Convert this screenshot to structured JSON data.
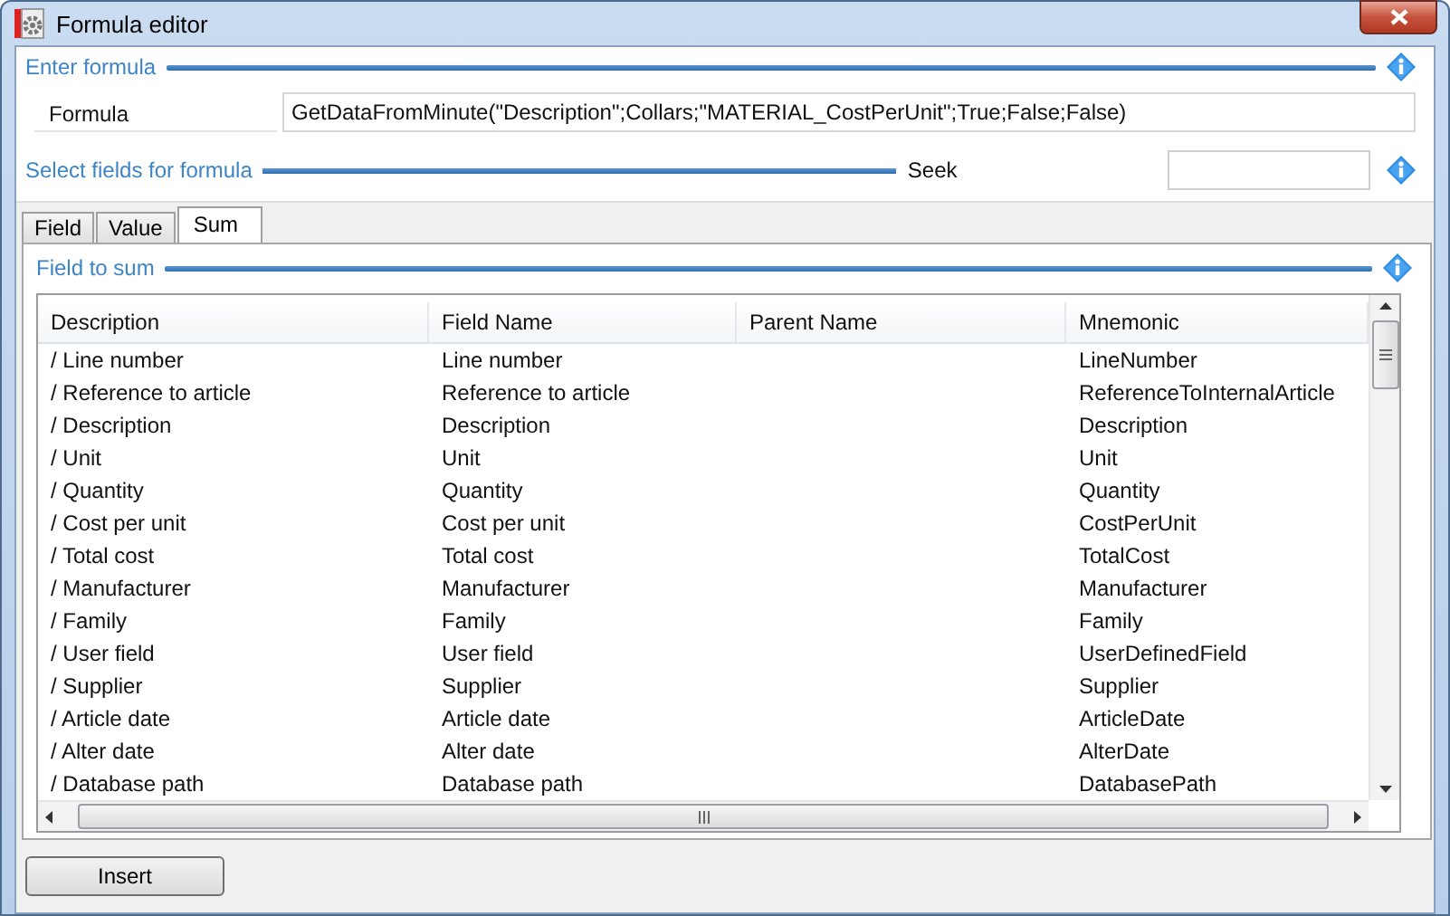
{
  "window": {
    "title": "Formula editor"
  },
  "formula_section": {
    "legend": "Enter formula",
    "label": "Formula",
    "value": "GetDataFromMinute(\"Description\";Collars;\"MATERIAL_CostPerUnit\";True;False;False)"
  },
  "fields_section": {
    "legend": "Select fields for formula",
    "seek_label": "Seek"
  },
  "tabs": [
    {
      "label": "Field",
      "selected": false
    },
    {
      "label": "Value",
      "selected": false
    },
    {
      "label": "Sum",
      "selected": true
    }
  ],
  "sum_panel": {
    "legend": "Field to sum"
  },
  "table": {
    "columns": [
      "Description",
      "Field Name",
      "Parent Name",
      "Mnemonic"
    ],
    "rows": [
      {
        "description": "/ Line number",
        "field_name": "Line number",
        "mnemonic": "LineNumber"
      },
      {
        "description": "/ Reference to article",
        "field_name": "Reference to article",
        "mnemonic": "ReferenceToInternalArticle"
      },
      {
        "description": "/ Description",
        "field_name": "Description",
        "mnemonic": "Description"
      },
      {
        "description": "/ Unit",
        "field_name": "Unit",
        "mnemonic": "Unit"
      },
      {
        "description": "/ Quantity",
        "field_name": "Quantity",
        "mnemonic": "Quantity"
      },
      {
        "description": "/ Cost per unit",
        "field_name": "Cost per unit",
        "mnemonic": "CostPerUnit"
      },
      {
        "description": "/ Total cost",
        "field_name": "Total cost",
        "mnemonic": "TotalCost"
      },
      {
        "description": "/ Manufacturer",
        "field_name": "Manufacturer",
        "mnemonic": "Manufacturer"
      },
      {
        "description": "/ Family",
        "field_name": "Family",
        "mnemonic": "Family"
      },
      {
        "description": "/ User field",
        "field_name": "User field",
        "mnemonic": "UserDefinedField"
      },
      {
        "description": "/ Supplier",
        "field_name": "Supplier",
        "mnemonic": "Supplier"
      },
      {
        "description": "/ Article date",
        "field_name": "Article date",
        "mnemonic": "ArticleDate"
      },
      {
        "description": "/ Alter date",
        "field_name": "Alter date",
        "mnemonic": "AlterDate"
      },
      {
        "description": "/ Database path",
        "field_name": "Database path",
        "mnemonic": "DatabasePath"
      }
    ]
  },
  "buttons": [
    "Insert"
  ]
}
